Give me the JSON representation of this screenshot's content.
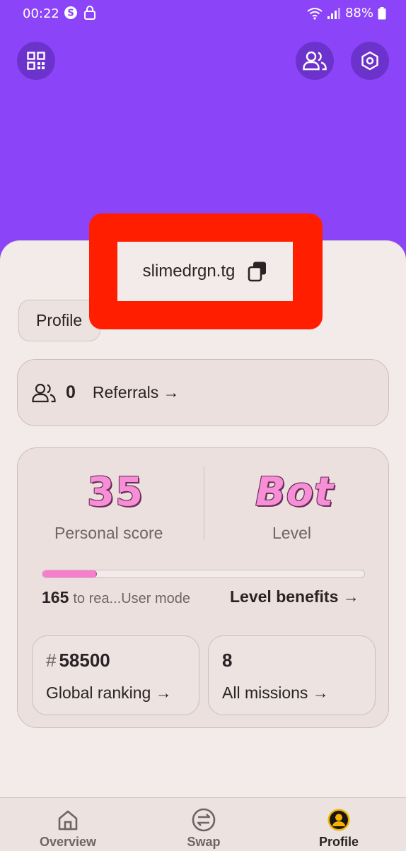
{
  "status_bar": {
    "time": "00:22",
    "battery": "88%"
  },
  "header": {
    "username": "slimedrgn.tg"
  },
  "tabs": {
    "profile_label": "Profile"
  },
  "referrals": {
    "count": "0",
    "label": "Referrals →"
  },
  "stats": {
    "personal_score": "35",
    "personal_score_label": "Personal score",
    "level": "Bot",
    "level_label": "Level",
    "progress_fraction": 0.17,
    "points_needed": "165",
    "points_text": "to rea...User mode",
    "benefits_label": "Level benefits →"
  },
  "ranking": {
    "prefix": "#",
    "value": "58500",
    "label": "Global ranking →"
  },
  "missions": {
    "value": "8",
    "label": "All missions →"
  },
  "bottom_nav": {
    "items": [
      {
        "label": "Overview",
        "icon": "home-icon"
      },
      {
        "label": "Swap",
        "icon": "swap-icon"
      },
      {
        "label": "Profile",
        "icon": "profile-icon",
        "active": true
      }
    ]
  },
  "colors": {
    "header": "#8b44f7",
    "accent_pink": "#f78fd6",
    "redaction": "#ff1f00",
    "background": "#f3ebea"
  }
}
